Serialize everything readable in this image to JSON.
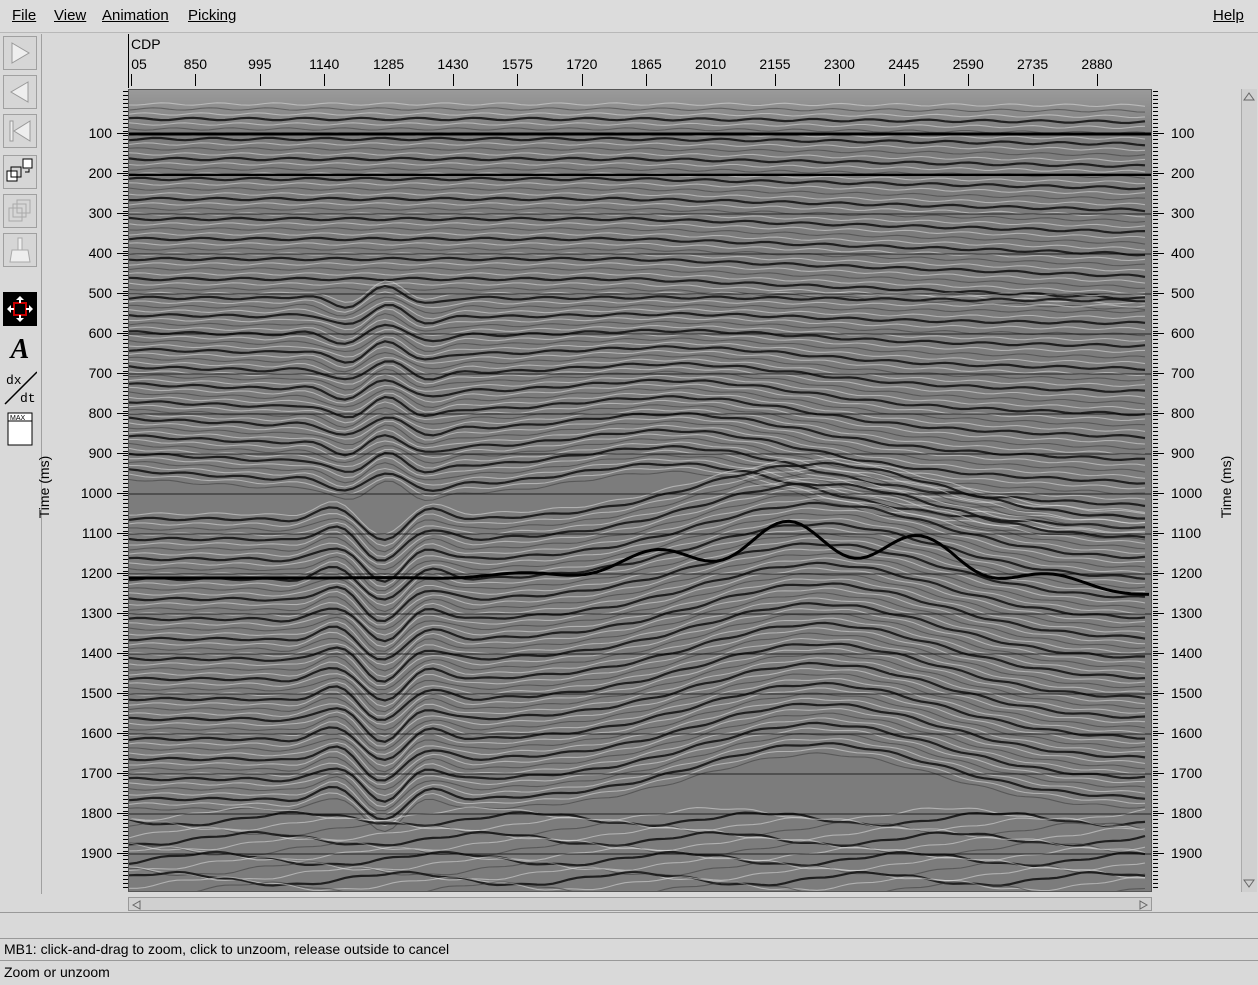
{
  "menu": {
    "file": "File",
    "view": "View",
    "animation": "Animation",
    "picking": "Picking",
    "help": "Help"
  },
  "toolbar": {
    "icons": [
      "play-forward-icon",
      "play-backward-icon",
      "rewind-to-start-icon",
      "copy-panel-icon",
      "stack-panels-icon",
      "broom-icon",
      "zoom-mode-icon",
      "annotate-text-icon",
      "derivative-icon",
      "max-amplitude-icon"
    ],
    "text_icon_label": "A",
    "derivative_top": "dx",
    "derivative_bottom": "dt",
    "max_label": "MAX"
  },
  "x_axis": {
    "label": "CDP",
    "ticks": [
      "05",
      "850",
      "995",
      "1140",
      "1285",
      "1430",
      "1575",
      "1720",
      "1865",
      "2010",
      "2155",
      "2300",
      "2445",
      "2590",
      "2735",
      "2880"
    ]
  },
  "y_axis": {
    "label": "Time (ms)",
    "ticks": [
      "100",
      "200",
      "300",
      "400",
      "500",
      "600",
      "700",
      "800",
      "900",
      "1000",
      "1100",
      "1200",
      "1300",
      "1400",
      "1500",
      "1600",
      "1700",
      "1800",
      "1900"
    ]
  },
  "status": {
    "hint": "MB1: click-and-drag to zoom, click to unzoom, release outside to cancel",
    "mode": "Zoom or unzoom"
  },
  "colors": {
    "background": "#d9d9d9",
    "seismic_mid": "#7a7a7a",
    "reflector": "#111111",
    "zoom_icon_bg": "#000000",
    "zoom_icon_accent": "#cc0000"
  }
}
